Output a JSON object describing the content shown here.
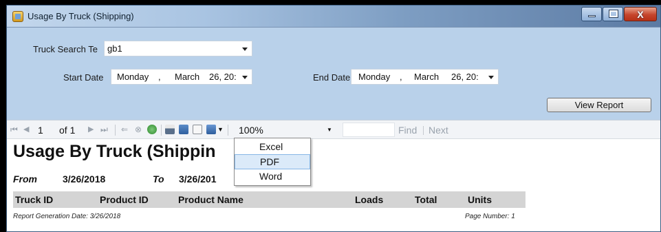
{
  "window": {
    "title": "Usage By Truck (Shipping)",
    "buttons": {
      "minimize": "minimize",
      "maximize": "maximize",
      "close": "X"
    }
  },
  "params": {
    "truck_search_label": "Truck Search Te",
    "truck_search_value": "gb1",
    "start_date_label": "Start Date",
    "start_date": {
      "day": "Monday",
      "sep": ",",
      "month": "March",
      "date": "26, 20:"
    },
    "end_date_label": "End Date",
    "end_date": {
      "day": "Monday",
      "sep": ",",
      "month": "March",
      "date": "26, 20:"
    },
    "view_report_label": "View Report"
  },
  "toolbar": {
    "page_current": "1",
    "page_of": "of 1",
    "zoom": "100%",
    "find_label": "Find",
    "next_label": "Next",
    "find_value": ""
  },
  "export_menu": {
    "items": [
      "Excel",
      "PDF",
      "Word"
    ],
    "highlighted": "PDF"
  },
  "report": {
    "title": "Usage By Truck (Shippin",
    "from_label": "From",
    "from_value": "3/26/2018",
    "to_label": "To",
    "to_value": "3/26/201",
    "columns": [
      "Truck ID",
      "Product ID",
      "Product Name",
      "Loads",
      "Total",
      "Units"
    ],
    "generation_date": "Report Generation Date: 3/26/2018",
    "page_number": "Page Number: 1"
  },
  "colors": {
    "param_bg": "#b9d1ea",
    "header_bg": "#d4d4d4",
    "menu_highlight": "#dbeaf9",
    "close_button": "#c6452c"
  },
  "icons": [
    "app-icon",
    "first-page-icon",
    "prev-page-icon",
    "next-page-icon",
    "last-page-icon",
    "back-icon",
    "stop-icon",
    "refresh-icon",
    "print-icon",
    "print-layout-icon",
    "page-setup-icon",
    "export-icon"
  ]
}
